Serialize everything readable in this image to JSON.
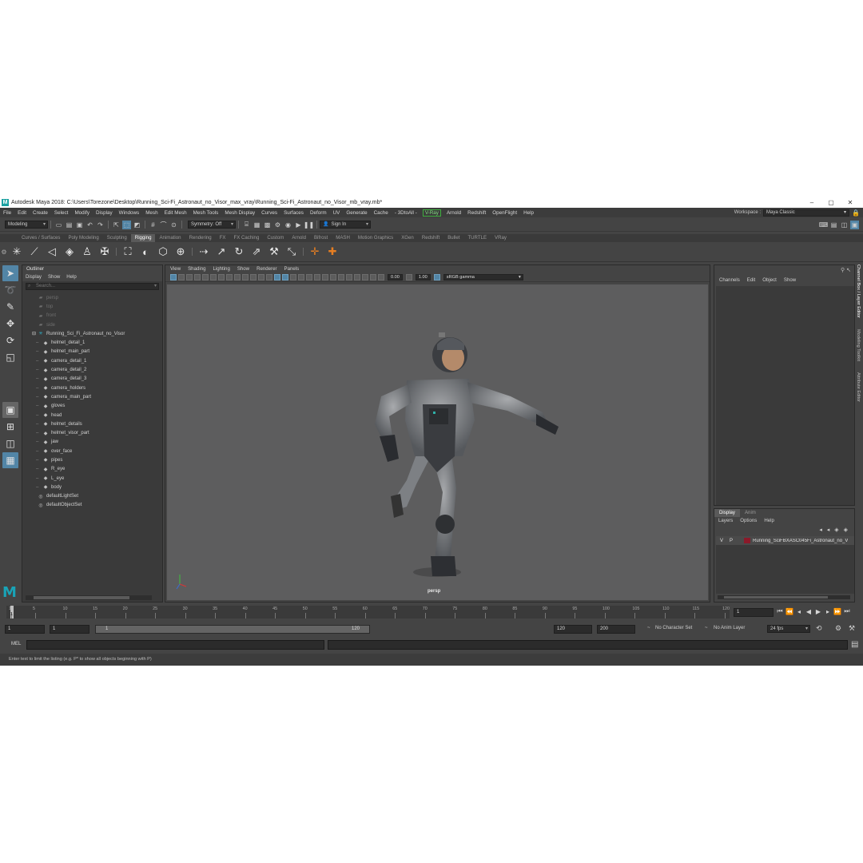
{
  "title_bar": {
    "title": "Autodesk Maya 2018: C:\\Users\\Torezone\\Desktop\\Running_Sci-Fi_Astronaut_no_Visor_max_vray\\Running_Sci-Fi_Astronaut_no_Visor_mb_vray.mb*",
    "logo": "M",
    "minimize": "–",
    "maximize": "▢",
    "close": "✕"
  },
  "menu_bar": {
    "items": [
      "File",
      "Edit",
      "Create",
      "Select",
      "Modify",
      "Display",
      "Windows",
      "Mesh",
      "Edit Mesh",
      "Mesh Tools",
      "Mesh Display",
      "Curves",
      "Surfaces",
      "Deform",
      "UV",
      "Generate",
      "Cache",
      "- 3DtoAll -",
      "V-Ray",
      "Arnold",
      "Redshift",
      "OpenFlight",
      "Help"
    ],
    "workspace_label": "Workspace :",
    "workspace_value": "Maya Classic"
  },
  "status_line": {
    "mode": "Modeling",
    "symmetry": "Symmetry: Off",
    "sign_in": "Sign In"
  },
  "shelf_tabs": [
    "Curves / Surfaces",
    "Poly Modeling",
    "Sculpting",
    "Rigging",
    "Animation",
    "Rendering",
    "FX",
    "FX Caching",
    "Custom",
    "Arnold",
    "Bifrost",
    "MASH",
    "Motion Graphics",
    "XGen",
    "Redshift",
    "Bullet",
    "TURTLE",
    "VRay"
  ],
  "active_shelf_tab": "Rigging",
  "outliner": {
    "title": "Outliner",
    "menu": [
      "Display",
      "Show",
      "Help"
    ],
    "search_placeholder": "Search...",
    "items": [
      {
        "label": "persp",
        "icon": "camera-icon",
        "dim": true,
        "indent": 1
      },
      {
        "label": "top",
        "icon": "camera-icon",
        "dim": true,
        "indent": 1
      },
      {
        "label": "front",
        "icon": "camera-icon",
        "dim": true,
        "indent": 1
      },
      {
        "label": "side",
        "icon": "camera-icon",
        "dim": true,
        "indent": 1
      },
      {
        "label": "Running_Sci_Fi_Astronaut_no_Visor",
        "icon": "joint-icon",
        "dim": false,
        "indent": 0
      },
      {
        "label": "helmet_detail_1",
        "icon": "mesh-icon",
        "dim": false,
        "indent": 2
      },
      {
        "label": "helmet_main_part",
        "icon": "mesh-icon",
        "dim": false,
        "indent": 2
      },
      {
        "label": "camera_detail_1",
        "icon": "mesh-icon",
        "dim": false,
        "indent": 2
      },
      {
        "label": "camera_detail_2",
        "icon": "mesh-icon",
        "dim": false,
        "indent": 2
      },
      {
        "label": "camera_detail_3",
        "icon": "mesh-icon",
        "dim": false,
        "indent": 2
      },
      {
        "label": "camera_holders",
        "icon": "mesh-icon",
        "dim": false,
        "indent": 2
      },
      {
        "label": "camera_main_part",
        "icon": "mesh-icon",
        "dim": false,
        "indent": 2
      },
      {
        "label": "gloves",
        "icon": "mesh-icon",
        "dim": false,
        "indent": 2
      },
      {
        "label": "head",
        "icon": "mesh-icon",
        "dim": false,
        "indent": 2
      },
      {
        "label": "helmet_details",
        "icon": "mesh-icon",
        "dim": false,
        "indent": 2
      },
      {
        "label": "helmet_visor_part",
        "icon": "mesh-icon",
        "dim": false,
        "indent": 2
      },
      {
        "label": "jaw",
        "icon": "mesh-icon",
        "dim": false,
        "indent": 2
      },
      {
        "label": "over_face",
        "icon": "mesh-icon",
        "dim": false,
        "indent": 2
      },
      {
        "label": "pipes",
        "icon": "mesh-icon",
        "dim": false,
        "indent": 2
      },
      {
        "label": "R_eye",
        "icon": "mesh-icon",
        "dim": false,
        "indent": 2
      },
      {
        "label": "L_eye",
        "icon": "mesh-icon",
        "dim": false,
        "indent": 2
      },
      {
        "label": "body",
        "icon": "mesh-icon",
        "dim": false,
        "indent": 2
      },
      {
        "label": "defaultLightSet",
        "icon": "set-icon",
        "dim": false,
        "indent": 1
      },
      {
        "label": "defaultObjectSet",
        "icon": "set-icon",
        "dim": false,
        "indent": 1
      }
    ]
  },
  "viewport": {
    "menu": [
      "View",
      "Shading",
      "Lighting",
      "Show",
      "Renderer",
      "Panels"
    ],
    "exposure": "0.00",
    "gamma": "1.00",
    "color_space": "sRGB gamma",
    "camera_label": "persp"
  },
  "channel_box": {
    "menu": [
      "Channels",
      "Edit",
      "Object",
      "Show"
    ]
  },
  "layer_editor": {
    "tabs": [
      "Display",
      "Anim"
    ],
    "active_tab": "Display",
    "menu": [
      "Layers",
      "Options",
      "Help"
    ],
    "layers": [
      {
        "v": "V",
        "p": "P",
        "name": "Running_SciFBXASC045Fi_Astronaut_no_V",
        "color": "#8b1a2a"
      }
    ]
  },
  "side_tabs": [
    "Channel Box / Layer Editor",
    "Modeling Toolkit",
    "Attribute Editor"
  ],
  "time_slider": {
    "ticks": [
      "1",
      "5",
      "10",
      "15",
      "20",
      "25",
      "30",
      "35",
      "40",
      "45",
      "50",
      "55",
      "60",
      "65",
      "70",
      "75",
      "80",
      "85",
      "90",
      "95",
      "100",
      "105",
      "110",
      "115",
      "120"
    ],
    "current_frame": "1",
    "current_frame_field": "1"
  },
  "range_slider": {
    "start": "1",
    "start_inner": "1",
    "bar_start": "1",
    "bar_end": "120",
    "end": "120",
    "end_outer": "200",
    "character_set": "No Character Set",
    "anim_layer": "No Anim Layer",
    "fps": "24 fps"
  },
  "command_line": {
    "label": "MEL"
  },
  "help_line": {
    "text": "Enter text to limit the listing (e.g. P* to show all objects beginning with P)"
  },
  "colors": {
    "accent": "#5285a6",
    "maya_logo": "#19a3b7",
    "vray_green": "#3fae3f",
    "layer_color": "#8b1a2a"
  }
}
